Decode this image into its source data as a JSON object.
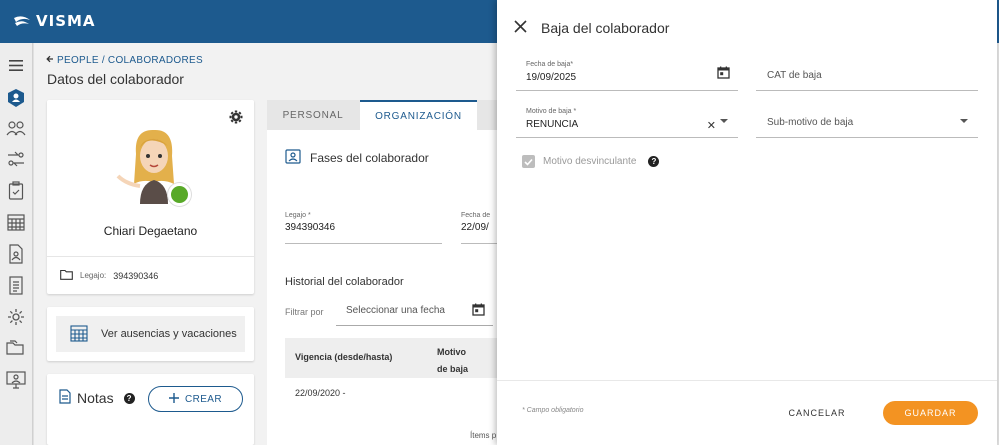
{
  "brand": {
    "name": "VISMA",
    "color": "#1d5a8e"
  },
  "sidebar": {
    "icons": [
      "menu-icon",
      "users-badge-icon",
      "team-icon",
      "transfer-icon",
      "clipboard-icon",
      "calendar-grid-icon",
      "document-user-icon",
      "document-list-icon",
      "settings-icon",
      "folders-icon",
      "monitor-user-icon"
    ]
  },
  "breadcrumb": {
    "items": [
      "PEOPLE",
      "COLABORADORES"
    ],
    "separator": "/"
  },
  "page": {
    "title": "Datos del colaborador"
  },
  "profile": {
    "name": "Chiari Degaetano",
    "legajo_label": "Legajo:",
    "legajo_value": "394390346",
    "status_color": "#58a928"
  },
  "absences": {
    "label": "Ver ausencias y vacaciones"
  },
  "notes": {
    "title": "Notas",
    "create_label": "CREAR"
  },
  "tabs": [
    {
      "label": "PERSONAL",
      "active": false
    },
    {
      "label": "ORGANIZACIÓN",
      "active": true
    }
  ],
  "organization": {
    "section_title": "Fases del colaborador",
    "legajo": {
      "label": "Legajo *",
      "value": "394390346"
    },
    "fecha": {
      "label": "Fecha de",
      "value": "22/09/"
    },
    "historial_title": "Historial del colaborador",
    "filter_label": "Filtrar por",
    "filter_placeholder": "Seleccionar una fecha",
    "table": {
      "headers": [
        "Vigencia (desde/hasta)",
        "Motivo de baja"
      ],
      "rows": [
        [
          "22/09/2020 -",
          ""
        ]
      ]
    },
    "items_per_page": "Ítems p"
  },
  "panel": {
    "title": "Baja del colaborador",
    "fecha_baja": {
      "label": "Fecha de baja*",
      "value": "19/09/2025"
    },
    "cat_baja": {
      "placeholder": "CAT de baja"
    },
    "motivo_baja": {
      "label": "Motivo de baja *",
      "value": "RENUNCIA"
    },
    "sub_motivo": {
      "placeholder": "Sub-motivo de baja"
    },
    "desvinculante": {
      "label": "Motivo desvinculante",
      "checked": true,
      "disabled": true
    },
    "required_note": "* Campo obligatorio",
    "cancel_label": "CANCELAR",
    "save_label": "GUARDAR",
    "accent_color": "#f39322"
  }
}
